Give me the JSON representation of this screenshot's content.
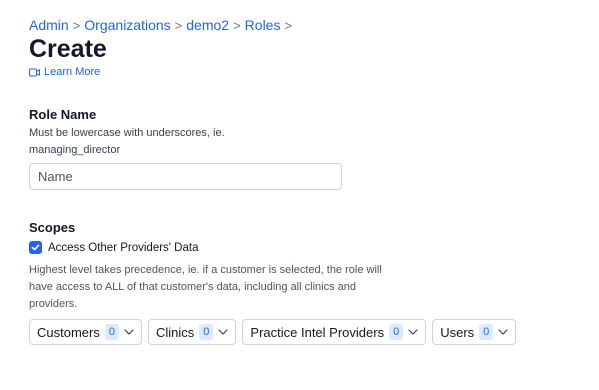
{
  "breadcrumb": {
    "items": [
      "Admin",
      "Organizations",
      "demo2",
      "Roles"
    ],
    "separator": ">"
  },
  "page": {
    "title": "Create",
    "learn_more": "Learn More"
  },
  "role_name": {
    "heading": "Role Name",
    "help": "Must be lowercase with underscores, ie. managing_director",
    "input_placeholder": "Name",
    "input_value": ""
  },
  "scopes": {
    "heading": "Scopes",
    "checkbox_label": "Access Other Providers' Data",
    "checkbox_checked": true,
    "help": "Highest level takes precedence, ie. if a customer is selected, the role will have access to ALL of that customer's data, including all clinics and providers.",
    "filters": [
      {
        "label": "Customers",
        "count": "0"
      },
      {
        "label": "Clinics",
        "count": "0"
      },
      {
        "label": "Practice Intel Providers",
        "count": "0"
      },
      {
        "label": "Users",
        "count": "0"
      }
    ]
  },
  "icons": {
    "learn_more": "video-icon",
    "checkbox": "check-icon",
    "filter": "chevron-down-icon"
  },
  "colors": {
    "accent": "#2563eb",
    "badge_bg": "#dbeafe",
    "border": "#d1d5db"
  }
}
